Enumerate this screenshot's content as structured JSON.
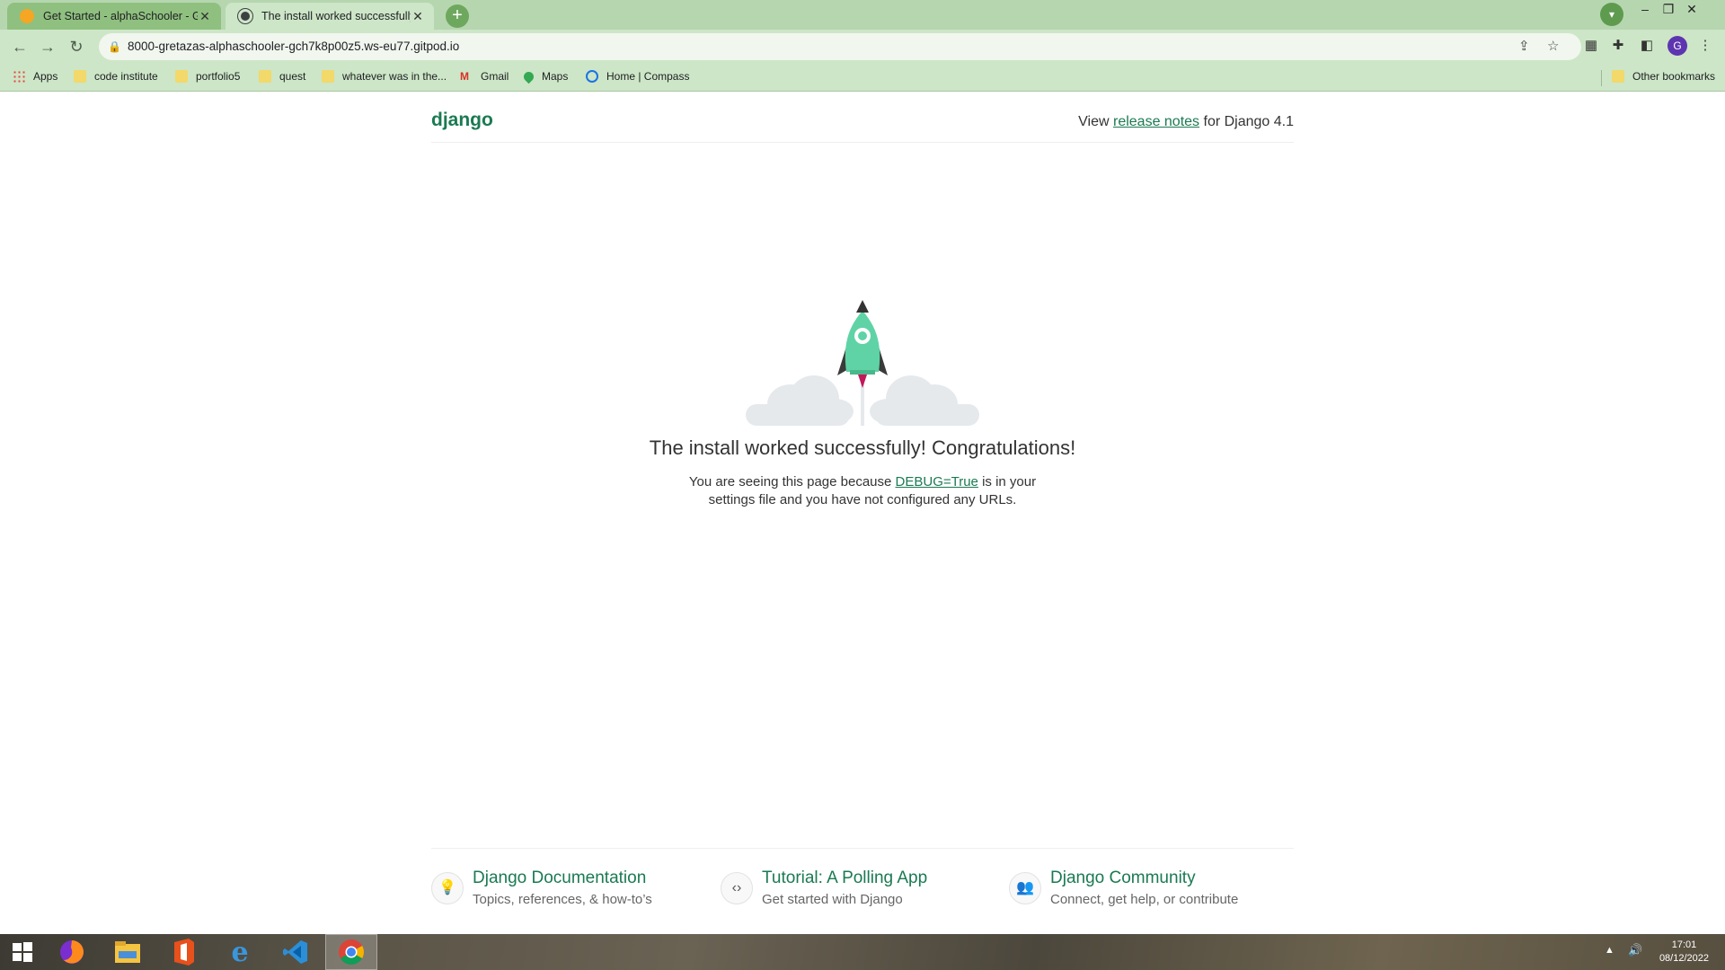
{
  "browser": {
    "tabs": [
      {
        "title": "Get Started - alphaSchooler - Git",
        "active": false
      },
      {
        "title": "The install worked successfully! C",
        "active": true
      }
    ],
    "url": "8000-gretazas-alphaschooler-gch7k8p00z5.ws-eu77.gitpod.io",
    "profile_initial": "G",
    "bookmarks": [
      {
        "label": "Apps",
        "icon": "apps-grid-icon"
      },
      {
        "label": "code institute",
        "icon": "folder-icon"
      },
      {
        "label": "portfolio5",
        "icon": "folder-icon"
      },
      {
        "label": "quest",
        "icon": "folder-icon"
      },
      {
        "label": "whatever was in the...",
        "icon": "folder-icon"
      },
      {
        "label": "Gmail",
        "icon": "gmail-icon"
      },
      {
        "label": "Maps",
        "icon": "maps-icon"
      },
      {
        "label": "Home | Compass",
        "icon": "compass-icon"
      }
    ],
    "other_bookmarks": "Other bookmarks"
  },
  "page": {
    "logo": "django",
    "release_prefix": "View ",
    "release_link": "release notes",
    "release_suffix": " for Django 4.1",
    "headline": "The install worked successfully! Congratulations!",
    "sub_prefix": "You are seeing this page because ",
    "sub_link": "DEBUG=True",
    "sub_suffix": " is in your settings file and you have not configured any URLs.",
    "footer": [
      {
        "title": "Django Documentation",
        "subtitle": "Topics, references, & how-to’s",
        "icon": "lightbulb-icon"
      },
      {
        "title": "Tutorial: A Polling App",
        "subtitle": "Get started with Django",
        "icon": "code-icon"
      },
      {
        "title": "Django Community",
        "subtitle": "Connect, get help, or contribute",
        "icon": "people-icon"
      }
    ]
  },
  "taskbar": {
    "time": "17:01",
    "date": "08/12/2022"
  },
  "colors": {
    "django_green": "#1a7a52",
    "rocket": "#5fd3a6",
    "chrome_frame": "#b6d6b0",
    "chrome_toolbar": "#cde6c7"
  }
}
